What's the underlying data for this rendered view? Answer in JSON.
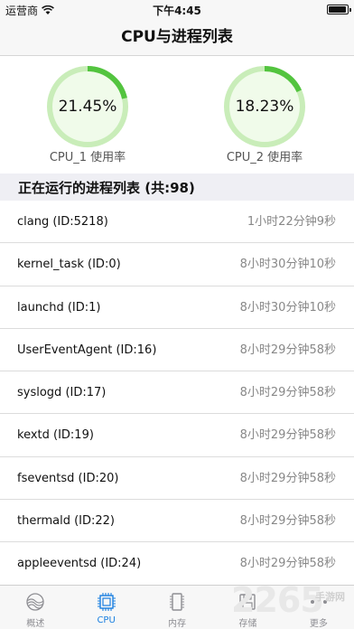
{
  "status": {
    "carrier": "运营商",
    "time": "下午4:45"
  },
  "nav": {
    "title": "CPU与进程列表"
  },
  "gauges": [
    {
      "value": "21.45%",
      "percent": 21.45,
      "label": "CPU_1 使用率"
    },
    {
      "value": "18.23%",
      "percent": 18.23,
      "label": "CPU_2 使用率"
    }
  ],
  "colors": {
    "gauge_track": "#c9edb9",
    "gauge_fill": "#53c43f",
    "gauge_inner": "#f0fbea",
    "accent": "#1a7fe0"
  },
  "section": {
    "title": "正在运行的进程列表 (共:98)"
  },
  "processes": [
    {
      "name": "clang (ID:5218)",
      "time": "1小时22分钟9秒"
    },
    {
      "name": "kernel_task (ID:0)",
      "time": "8小时30分钟10秒"
    },
    {
      "name": "launchd (ID:1)",
      "time": "8小时30分钟10秒"
    },
    {
      "name": "UserEventAgent (ID:16)",
      "time": "8小时29分钟58秒"
    },
    {
      "name": "syslogd (ID:17)",
      "time": "8小时29分钟58秒"
    },
    {
      "name": "kextd (ID:19)",
      "time": "8小时29分钟58秒"
    },
    {
      "name": "fseventsd (ID:20)",
      "time": "8小时29分钟58秒"
    },
    {
      "name": "thermald (ID:22)",
      "time": "8小时29分钟58秒"
    },
    {
      "name": "appleeventsd (ID:24)",
      "time": "8小时29分钟58秒"
    }
  ],
  "tabs": [
    {
      "label": "概述",
      "icon": "overview-icon",
      "active": false
    },
    {
      "label": "CPU",
      "icon": "cpu-chip-icon",
      "active": true
    },
    {
      "label": "内存",
      "icon": "memory-chip-icon",
      "active": false
    },
    {
      "label": "存储",
      "icon": "storage-disk-icon",
      "active": false
    },
    {
      "label": "更多",
      "icon": "more-icon",
      "active": false
    }
  ],
  "watermark": {
    "number": "2265",
    "site": "手游网"
  }
}
